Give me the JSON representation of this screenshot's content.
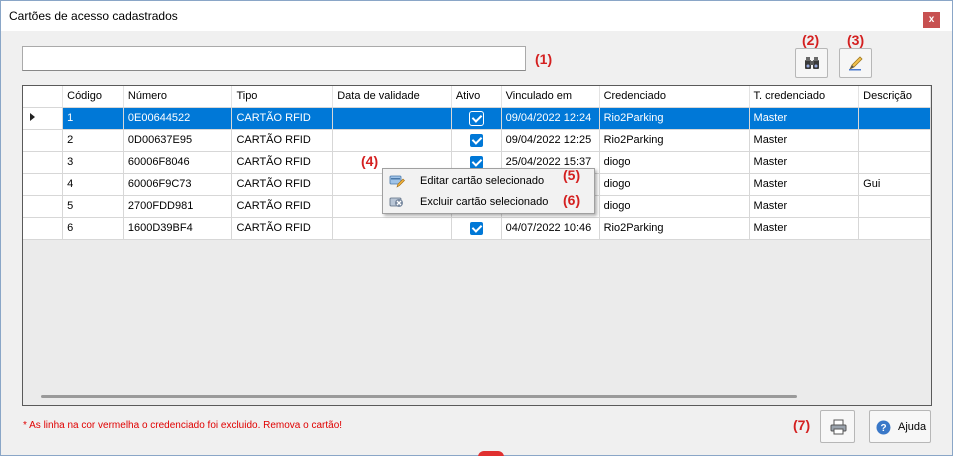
{
  "window": {
    "title": "Cartões de acesso cadastrados",
    "close_label": "x"
  },
  "search": {
    "value": "",
    "placeholder": ""
  },
  "callouts": {
    "c1": "(1)",
    "c2": "(2)",
    "c3": "(3)",
    "c4": "(4)",
    "c5": "(5)",
    "c6": "(6)",
    "c7": "(7)"
  },
  "toolbar": {
    "search_icon": "binoculars-icon",
    "edit_icon": "pencil-icon"
  },
  "grid": {
    "columns": [
      "",
      "Código",
      "Número",
      "Tipo",
      "Data de validade",
      "Ativo",
      "Vinculado em",
      "Credenciado",
      "T. credenciado",
      "Descrição"
    ],
    "rows": [
      {
        "codigo": "1",
        "numero": "0E00644522",
        "tipo": "CARTÃO RFID",
        "validade": "",
        "ativo": true,
        "vinculado": "09/04/2022 12:24",
        "credenciado": "Rio2Parking",
        "tcred": "Master",
        "descricao": "",
        "selected": true
      },
      {
        "codigo": "2",
        "numero": "0D00637E95",
        "tipo": "CARTÃO RFID",
        "validade": "",
        "ativo": true,
        "vinculado": "09/04/2022 12:25",
        "credenciado": "Rio2Parking",
        "tcred": "Master",
        "descricao": "",
        "selected": false
      },
      {
        "codigo": "3",
        "numero": "60006F8046",
        "tipo": "CARTÃO RFID",
        "validade": "",
        "ativo": true,
        "vinculado": "25/04/2022 15:37",
        "credenciado": "diogo",
        "tcred": "Master",
        "descricao": "",
        "selected": false
      },
      {
        "codigo": "4",
        "numero": "60006F9C73",
        "tipo": "CARTÃO RFID",
        "validade": "",
        "ativo": true,
        "vinculado": "",
        "credenciado": "diogo",
        "tcred": "Master",
        "descricao": "Gui",
        "selected": false
      },
      {
        "codigo": "5",
        "numero": "2700FDD981",
        "tipo": "CARTÃO RFID",
        "validade": "",
        "ativo": true,
        "vinculado": "",
        "credenciado": "diogo",
        "tcred": "Master",
        "descricao": "",
        "selected": false
      },
      {
        "codigo": "6",
        "numero": "1600D39BF4",
        "tipo": "CARTÃO RFID",
        "validade": "",
        "ativo": true,
        "vinculado": "04/07/2022 10:46",
        "credenciado": "Rio2Parking",
        "tcred": "Master",
        "descricao": "",
        "selected": false
      }
    ]
  },
  "context_menu": {
    "items": [
      {
        "label": "Editar cartão selecionado",
        "icon": "edit-card-icon"
      },
      {
        "label": "Excluir cartão selecionado",
        "icon": "delete-card-icon"
      }
    ]
  },
  "footer": {
    "note": "* As linha na cor vermelha o credenciado foi excluido. Remova o cartão!",
    "print_icon": "printer-icon",
    "help_label": "Ajuda",
    "help_icon": "help-icon"
  },
  "colors": {
    "selection": "#0078d7",
    "callout": "#d42020",
    "note": "#e00000"
  }
}
